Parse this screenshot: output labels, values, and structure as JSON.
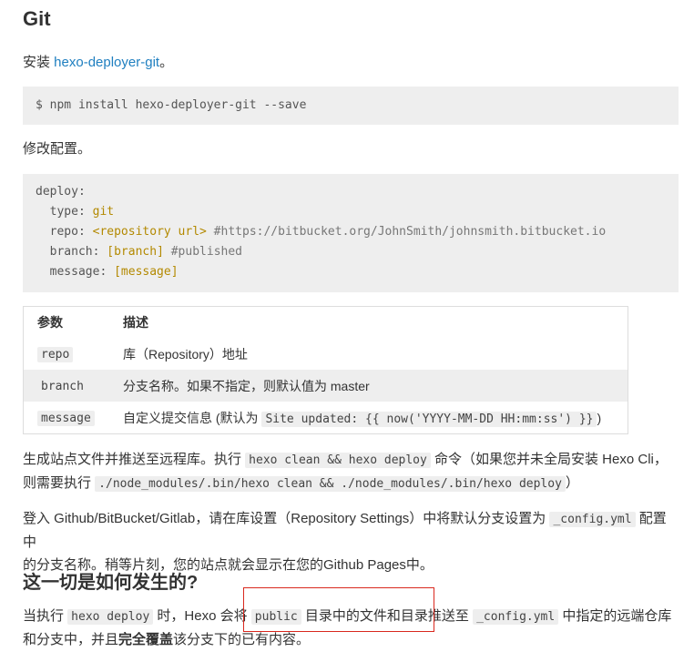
{
  "heading_git": "Git",
  "install_text": "安装 ",
  "install_link": "hexo-deployer-git",
  "install_suffix": "。",
  "install_cmd": "$ npm install hexo-deployer-git --save",
  "config_text": "修改配置。",
  "config_code": {
    "deploy": "deploy:",
    "type_key": "  type: ",
    "type_val": "git",
    "repo_key": "  repo: ",
    "repo_val": "<repository url>",
    "repo_comment": " #https://bitbucket.org/JohnSmith/johnsmith.bitbucket.io",
    "branch_key": "  branch: ",
    "branch_val": "[branch]",
    "branch_comment": " #published",
    "message_key": "  message: ",
    "message_val": "[message]"
  },
  "table": {
    "headers": [
      "参数",
      "描述"
    ],
    "rows": [
      {
        "param": "repo",
        "desc": "库（Repository）地址"
      },
      {
        "param": "branch",
        "desc": "分支名称。如果不指定，则默认值为 master"
      },
      {
        "param": "message",
        "desc_pre": "自定义提交信息 (默认为 ",
        "desc_code": "Site updated: {{ now('YYYY-MM-DD HH:mm:ss') }}",
        "desc_post": ")"
      }
    ]
  },
  "para_generate": {
    "t1": "生成站点文件并推送至远程库。执行 ",
    "c1": "hexo clean && hexo deploy",
    "t2": " 命令（如果您并未全局安装 Hexo Cli，",
    "t3": "则需要执行 ",
    "c2": "./node_modules/.bin/hexo clean && ./node_modules/.bin/hexo deploy",
    "t4": "）"
  },
  "para_login": {
    "t1": "登入 Github/BitBucket/Gitlab，请在库设置（Repository Settings）中将默认分支设置为 ",
    "c1": "_config.yml",
    "t2": " 配置中",
    "t3": "的分支名称。稍等片刻，您的站点就会显示在您的Github Pages中。"
  },
  "heading_how": "这一切是如何发生的?",
  "para_how": {
    "t1": "当执行 ",
    "c1": "hexo deploy",
    "t2": " 时，Hexo 会将 ",
    "c2": "public",
    "t3": " 目录中的文件和目录推送至 ",
    "c3": "_config.yml",
    "t4": " 中指定的远端仓库",
    "t5": "和分支中，并且",
    "bold": "完全覆盖",
    "t6": "该分支下的已有内容。"
  }
}
